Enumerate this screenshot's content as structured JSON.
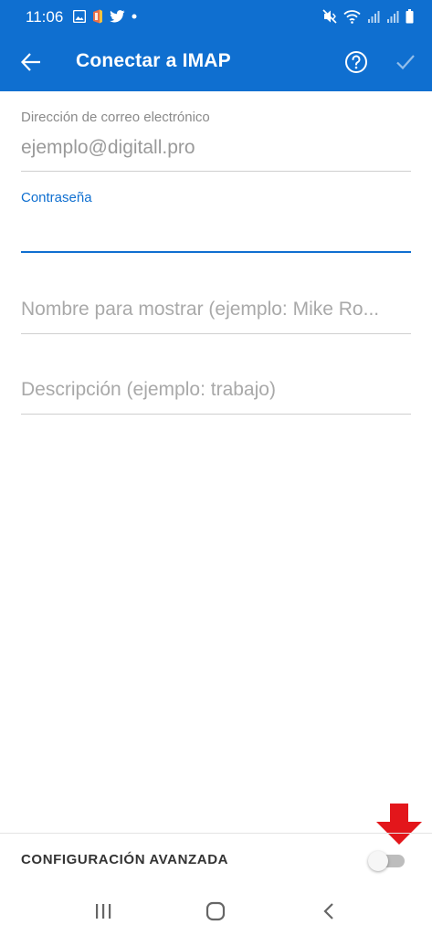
{
  "colors": {
    "accent": "#0F6FD0",
    "header_text": "#FFFFFF",
    "label_gray": "#8A8A8A",
    "placeholder_gray": "#A9A9A9",
    "divider": "#CFCFCF",
    "annotation_red": "#E3161B"
  },
  "status_bar": {
    "time": "11:06",
    "left_icons": [
      "gallery-icon",
      "office-icon",
      "twitter-icon",
      "dot-icon"
    ],
    "right_icons": [
      "mute-vibrate-icon",
      "wifi-icon",
      "signal-icon",
      "signal-icon",
      "battery-icon"
    ]
  },
  "app_bar": {
    "title": "Conectar a IMAP",
    "back_icon": "arrow-left-icon",
    "help_icon": "help-circle-icon",
    "done_icon": "check-icon"
  },
  "form": {
    "email": {
      "label": "Dirección de correo electrónico",
      "value": "ejemplo@digitall.pro"
    },
    "password": {
      "label": "Contraseña",
      "value": ""
    },
    "display_name": {
      "placeholder": "Nombre para mostrar (ejemplo: Mike Ro..."
    },
    "description": {
      "placeholder": "Descripción (ejemplo: trabajo)"
    }
  },
  "advanced": {
    "label": "CONFIGURACIÓN AVANZADA",
    "enabled": false
  },
  "annotation": {
    "icon": "red-down-arrow-icon"
  },
  "nav_bar": {
    "recents_icon": "recents-icon",
    "home_icon": "home-icon",
    "back_icon": "chevron-left-icon"
  }
}
